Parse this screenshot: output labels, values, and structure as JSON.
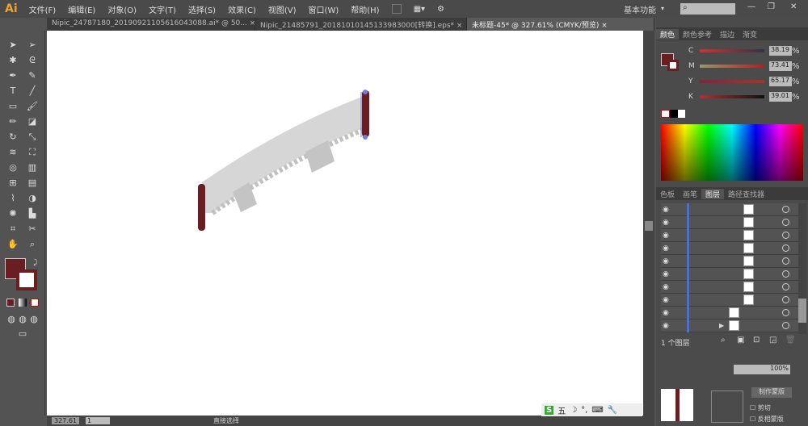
{
  "app": {
    "logo": "Ai",
    "menus": [
      "文件(F)",
      "编辑(E)",
      "对象(O)",
      "文字(T)",
      "选择(S)",
      "效果(C)",
      "视图(V)",
      "窗口(W)",
      "帮助(H)"
    ],
    "workspace": "基本功能",
    "search_placeholder": ""
  },
  "tabs": [
    {
      "label": "Nipic_24787180_20190921105616043088.ai* @ 50... ×"
    },
    {
      "label": "Nipic_21485791_20181010145133983000[转换].eps* ×"
    },
    {
      "label": "未标题-45* @ 327.61% (CMYK/预览) ×",
      "active": true
    }
  ],
  "color_panel": {
    "tabs": [
      "颜色",
      "颜色参考",
      "描边",
      "渐变"
    ],
    "fill_color": "#6b1e22",
    "sliders": [
      {
        "label": "C",
        "value": "38.19",
        "fraction": 0.38
      },
      {
        "label": "M",
        "value": "73.41",
        "fraction": 0.73
      },
      {
        "label": "Y",
        "value": "65.17",
        "fraction": 0.65
      },
      {
        "label": "K",
        "value": "39.01",
        "fraction": 0.39
      }
    ],
    "unit": "%"
  },
  "layers_panel": {
    "tabs": [
      "色板",
      "画笔",
      "图层",
      "路径查找器"
    ],
    "layer_count": "1 个图层",
    "row_count": 10
  },
  "transparency": {
    "opacity": "100%",
    "button": "制作蒙版",
    "options": [
      "剪切",
      "反相蒙版"
    ]
  },
  "status": {
    "zoom": "327.61",
    "page": "1",
    "tool": "直接选择"
  },
  "ime": {
    "label": "五"
  }
}
